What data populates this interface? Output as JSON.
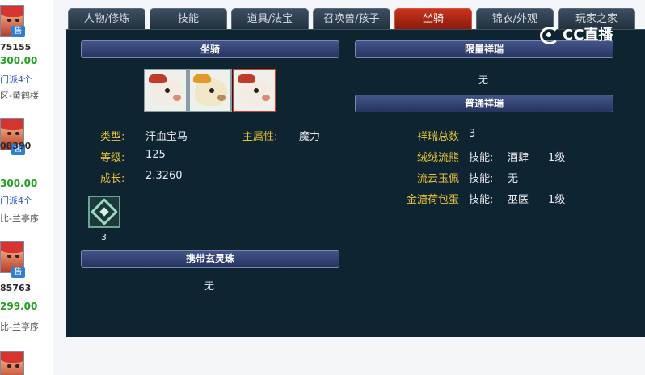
{
  "listings": [
    {
      "id": "75155",
      "price": "300.00",
      "sect": "门派4个",
      "server": "区-黄鹤楼",
      "sell_tag": "售"
    },
    {
      "id": "08390",
      "price": "300.00",
      "sect": "门派4个",
      "server": "比-兰亭序",
      "sell_tag": "售"
    },
    {
      "id": "85763",
      "price": "299.00",
      "sect": "",
      "server": "比-兰亭序",
      "sell_tag": "售"
    }
  ],
  "tabs": [
    {
      "label": "人物/修炼",
      "active": false
    },
    {
      "label": "技能",
      "active": false
    },
    {
      "label": "道具/法宝",
      "active": false
    },
    {
      "label": "召唤兽/孩子",
      "active": false
    },
    {
      "label": "坐骑",
      "active": true
    },
    {
      "label": "锦衣/外观",
      "active": false
    },
    {
      "label": "玩家之家",
      "active": false
    }
  ],
  "mount_section": {
    "header": "坐骑",
    "mounts": [
      {
        "icon": "pony-mount-icon",
        "selected": false
      },
      {
        "icon": "sheep-mount-icon",
        "selected": false
      },
      {
        "icon": "pony-mount-icon",
        "selected": true
      }
    ],
    "type_label": "类型:",
    "type_value": "汗血宝马",
    "attr_label": "主属性:",
    "attr_value": "魔力",
    "level_label": "等级:",
    "level_value": "125",
    "growth_label": "成长:",
    "growth_value": "2.3260",
    "skill_icon": "skill-book-icon",
    "skill_count": "3"
  },
  "orb_section": {
    "header": "携带玄灵珠",
    "value": "无"
  },
  "limited_section": {
    "header": "限量祥瑞",
    "value": "无"
  },
  "normal_section": {
    "header": "普通祥瑞",
    "total_label": "祥瑞总数",
    "total_value": "3",
    "items": [
      {
        "name": "绒绒流熊",
        "skill_label": "技能:",
        "skill": "酒肆",
        "level": "1级"
      },
      {
        "name": "流云玉佩",
        "skill_label": "技能:",
        "skill": "无",
        "level": ""
      },
      {
        "name": "金溏荷包蛋",
        "skill_label": "技能:",
        "skill": "巫医",
        "level": "1级"
      }
    ]
  },
  "watermark": {
    "text": "CC直播",
    "icon": "cc-logo-icon"
  },
  "colors": {
    "panel": "#0e2430",
    "active_tab": "#c8351e",
    "label": "#e8c23a",
    "price": "#21a021",
    "link": "#2d58c8"
  }
}
